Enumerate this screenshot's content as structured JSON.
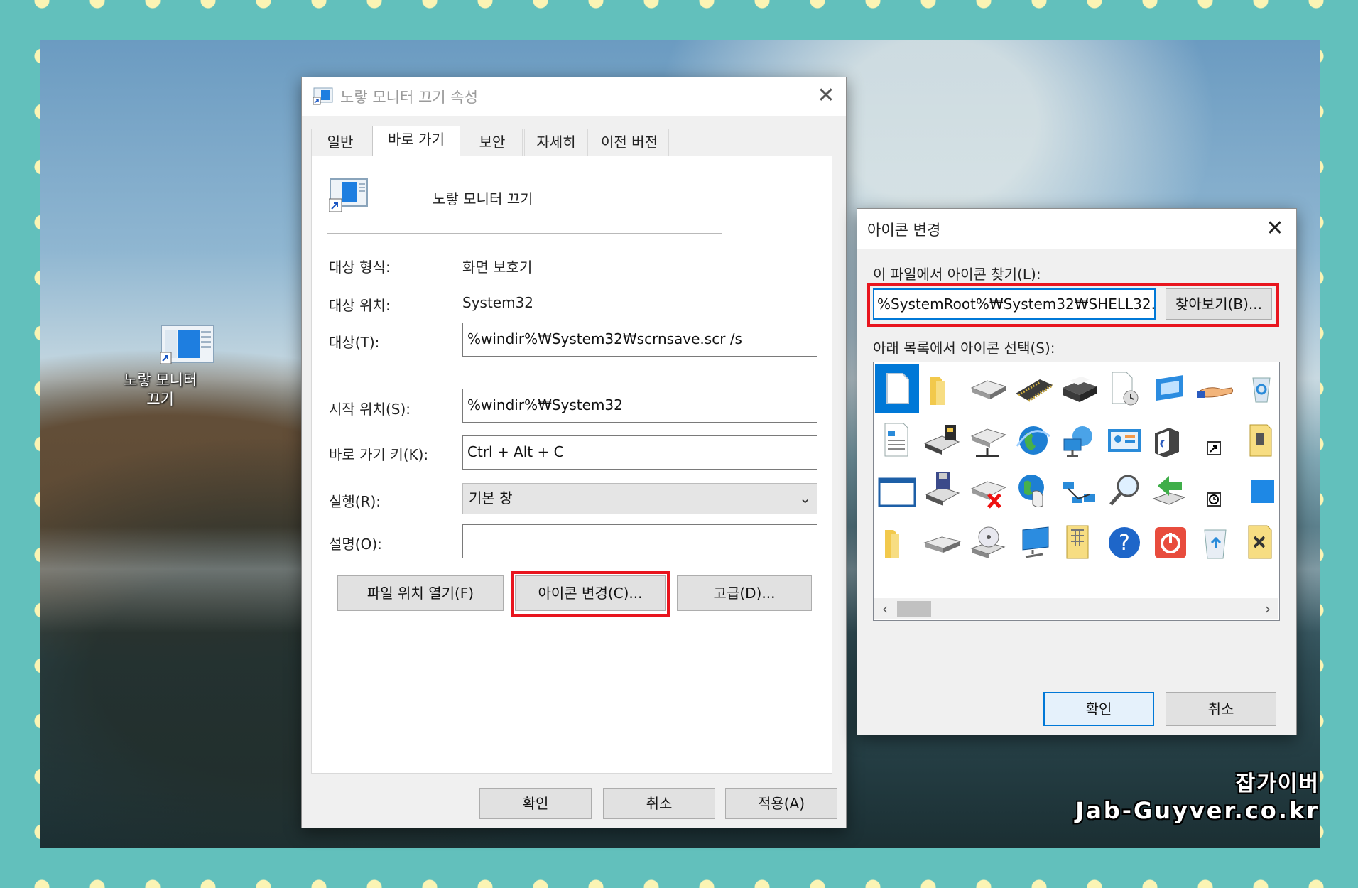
{
  "desktop": {
    "icon_label_line1": "노랗 모니터",
    "icon_label_line2": "끄기"
  },
  "properties_dialog": {
    "title": "노랗 모니터 끄기 속성",
    "tabs": [
      "일반",
      "바로 가기",
      "보안",
      "자세히",
      "이전 버전"
    ],
    "active_tab": "바로 가기",
    "shortcut_name": "노랗 모니터 끄기",
    "target_type_label": "대상 형식:",
    "target_type_value": "화면 보호기",
    "target_location_label": "대상 위치:",
    "target_location_value": "System32",
    "target_label": "대상(T):",
    "target_value": "%windir%₩System32₩scrnsave.scr /s",
    "start_in_label": "시작 위치(S):",
    "start_in_value": "%windir%₩System32",
    "shortcut_key_label": "바로 가기 키(K):",
    "shortcut_key_value": "Ctrl + Alt + C",
    "run_label": "실행(R):",
    "run_value": "기본 창",
    "comment_label": "설명(O):",
    "comment_value": "",
    "open_location_button": "파일 위치 열기(F)",
    "change_icon_button": "아이콘 변경(C)...",
    "advanced_button": "고급(D)...",
    "ok_button": "확인",
    "cancel_button": "취소",
    "apply_button": "적용(A)"
  },
  "change_icon_dialog": {
    "title": "아이콘 변경",
    "look_in_label": "이 파일에서 아이콘 찾기(L):",
    "look_in_value": "%SystemRoot%₩System32₩SHELL32.dll",
    "browse_button": "찾아보기(B)...",
    "select_label": "아래 목록에서 아이콘 선택(S):",
    "icons": [
      "blank-document-icon",
      "folder-icon",
      "drive-icon",
      "memory-chip-icon",
      "printer-icon",
      "document-clock-icon",
      "monitor-window-icon",
      "hand-icon",
      "recycle-icon",
      "text-document-icon",
      "pc-drive-icon",
      "network-drive-icon",
      "globe-icon",
      "network-globe-icon",
      "control-panel-icon",
      "moon-drive-icon",
      "shortcut-arrow-icon",
      "document-yellow-icon",
      "window-icon",
      "floppy-icon",
      "disconnected-drive-icon",
      "globe-mouse-icon",
      "network-icon",
      "search-icon",
      "green-arrow-icon",
      "clock-overlay-icon",
      "blue-square-icon",
      "folder-small-icon",
      "flat-drive-icon",
      "cd-drive-icon",
      "computer-icon",
      "folder-grid-icon",
      "help-icon",
      "power-icon",
      "recycle-bin-icon",
      "tools-icon"
    ],
    "ok_button": "확인",
    "cancel_button": "취소"
  },
  "watermark": {
    "korean": "잡가이버",
    "english": "Jab-Guyver.co.kr"
  },
  "colors": {
    "highlight_red": "#e8151e",
    "selection_blue": "#0078d7",
    "frame_teal": "#62c0bc"
  }
}
